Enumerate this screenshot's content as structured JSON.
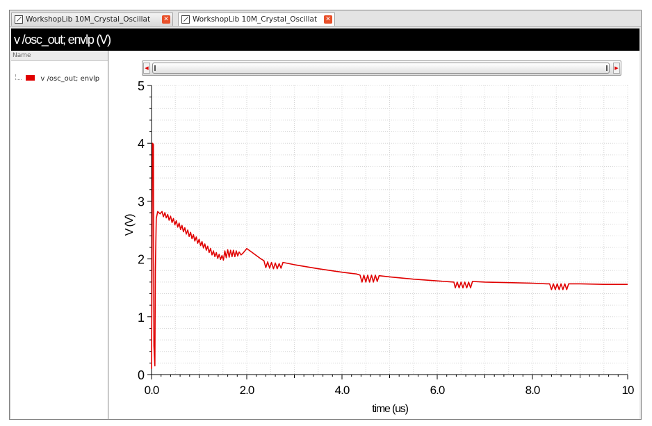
{
  "tabs": [
    {
      "label": "WorkshopLib 10M_Crystal_Oscillat...",
      "active": false
    },
    {
      "label": "WorkshopLib 10M_Crystal_Oscillat...",
      "active": true
    }
  ],
  "window": {
    "title": "v /osc_out; envlp (V)"
  },
  "legend": {
    "header": "Name",
    "items": [
      {
        "label": "v /osc_out; envlp",
        "color": "#e00000"
      }
    ]
  },
  "icons": {
    "tab": "document-icon",
    "tab_close": "close-icon",
    "scroll_left": "scroll-left-arrow-icon",
    "scroll_right": "scroll-right-arrow-icon"
  },
  "chart_data": {
    "type": "line",
    "xlabel": "time (us)",
    "ylabel": "V (V)",
    "xlim": [
      0,
      10
    ],
    "ylim": [
      0,
      5
    ],
    "x_ticks": [
      0.0,
      2.0,
      4.0,
      6.0,
      8.0,
      10
    ],
    "x_tick_labels": [
      "0.0",
      "2.0",
      "4.0",
      "6.0",
      "8.0",
      "10"
    ],
    "y_ticks": [
      0,
      1,
      2,
      3,
      4,
      5
    ],
    "y_tick_labels": [
      "0",
      "1",
      "2",
      "3",
      "4",
      "5"
    ],
    "grid": true,
    "series": [
      {
        "name": "v /osc_out; envlp",
        "color": "#e00000",
        "points": [
          [
            0.0,
            0.1
          ],
          [
            0.02,
            4.0
          ],
          [
            0.04,
            3.98
          ],
          [
            0.05,
            0.5
          ],
          [
            0.07,
            0.15
          ],
          [
            0.08,
            1.8
          ],
          [
            0.1,
            2.7
          ],
          [
            0.13,
            2.82
          ],
          [
            0.18,
            2.78
          ],
          [
            0.22,
            2.82
          ],
          [
            0.25,
            2.73
          ],
          [
            0.28,
            2.8
          ],
          [
            0.31,
            2.71
          ],
          [
            0.34,
            2.77
          ],
          [
            0.37,
            2.67
          ],
          [
            0.4,
            2.74
          ],
          [
            0.43,
            2.63
          ],
          [
            0.46,
            2.7
          ],
          [
            0.49,
            2.59
          ],
          [
            0.52,
            2.66
          ],
          [
            0.55,
            2.55
          ],
          [
            0.58,
            2.62
          ],
          [
            0.61,
            2.51
          ],
          [
            0.64,
            2.58
          ],
          [
            0.67,
            2.47
          ],
          [
            0.7,
            2.54
          ],
          [
            0.73,
            2.43
          ],
          [
            0.76,
            2.5
          ],
          [
            0.79,
            2.39
          ],
          [
            0.82,
            2.46
          ],
          [
            0.85,
            2.35
          ],
          [
            0.88,
            2.42
          ],
          [
            0.91,
            2.31
          ],
          [
            0.94,
            2.38
          ],
          [
            0.97,
            2.27
          ],
          [
            1.0,
            2.34
          ],
          [
            1.03,
            2.23
          ],
          [
            1.06,
            2.3
          ],
          [
            1.09,
            2.19
          ],
          [
            1.12,
            2.26
          ],
          [
            1.15,
            2.15
          ],
          [
            1.18,
            2.22
          ],
          [
            1.21,
            2.11
          ],
          [
            1.24,
            2.18
          ],
          [
            1.27,
            2.07
          ],
          [
            1.3,
            2.14
          ],
          [
            1.33,
            2.04
          ],
          [
            1.36,
            2.11
          ],
          [
            1.39,
            2.01
          ],
          [
            1.42,
            2.08
          ],
          [
            1.45,
            1.99
          ],
          [
            1.48,
            2.06
          ],
          [
            1.51,
            1.98
          ],
          [
            1.54,
            2.14
          ],
          [
            1.57,
            2.02
          ],
          [
            1.6,
            2.16
          ],
          [
            1.63,
            2.03
          ],
          [
            1.66,
            2.15
          ],
          [
            1.69,
            2.04
          ],
          [
            1.72,
            2.15
          ],
          [
            1.75,
            2.04
          ],
          [
            1.78,
            2.14
          ],
          [
            1.81,
            2.05
          ],
          [
            1.84,
            2.12
          ],
          [
            1.88,
            2.07
          ],
          [
            1.92,
            2.1
          ],
          [
            1.96,
            2.14
          ],
          [
            2.0,
            2.18
          ],
          [
            2.1,
            2.12
          ],
          [
            2.2,
            2.06
          ],
          [
            2.3,
            2.0
          ],
          [
            2.36,
            1.97
          ],
          [
            2.4,
            1.85
          ],
          [
            2.44,
            1.95
          ],
          [
            2.48,
            1.84
          ],
          [
            2.52,
            1.94
          ],
          [
            2.56,
            1.83
          ],
          [
            2.6,
            1.93
          ],
          [
            2.64,
            1.83
          ],
          [
            2.68,
            1.92
          ],
          [
            2.72,
            1.84
          ],
          [
            2.76,
            1.94
          ],
          [
            3.0,
            1.9
          ],
          [
            3.5,
            1.83
          ],
          [
            4.0,
            1.77
          ],
          [
            4.3,
            1.74
          ],
          [
            4.38,
            1.72
          ],
          [
            4.42,
            1.6
          ],
          [
            4.46,
            1.72
          ],
          [
            4.5,
            1.6
          ],
          [
            4.54,
            1.72
          ],
          [
            4.58,
            1.6
          ],
          [
            4.62,
            1.72
          ],
          [
            4.66,
            1.6
          ],
          [
            4.7,
            1.72
          ],
          [
            4.74,
            1.61
          ],
          [
            4.78,
            1.71
          ],
          [
            5.0,
            1.69
          ],
          [
            5.5,
            1.65
          ],
          [
            6.0,
            1.62
          ],
          [
            6.35,
            1.6
          ],
          [
            6.38,
            1.5
          ],
          [
            6.42,
            1.6
          ],
          [
            6.46,
            1.5
          ],
          [
            6.5,
            1.6
          ],
          [
            6.54,
            1.5
          ],
          [
            6.58,
            1.6
          ],
          [
            6.62,
            1.5
          ],
          [
            6.66,
            1.6
          ],
          [
            6.7,
            1.5
          ],
          [
            6.74,
            1.61
          ],
          [
            7.0,
            1.6
          ],
          [
            7.5,
            1.59
          ],
          [
            8.0,
            1.58
          ],
          [
            8.3,
            1.57
          ],
          [
            8.36,
            1.57
          ],
          [
            8.4,
            1.47
          ],
          [
            8.44,
            1.57
          ],
          [
            8.48,
            1.47
          ],
          [
            8.52,
            1.57
          ],
          [
            8.56,
            1.47
          ],
          [
            8.6,
            1.57
          ],
          [
            8.64,
            1.47
          ],
          [
            8.68,
            1.57
          ],
          [
            8.72,
            1.47
          ],
          [
            8.76,
            1.57
          ],
          [
            9.0,
            1.57
          ],
          [
            9.5,
            1.56
          ],
          [
            10.0,
            1.56
          ]
        ]
      }
    ]
  }
}
